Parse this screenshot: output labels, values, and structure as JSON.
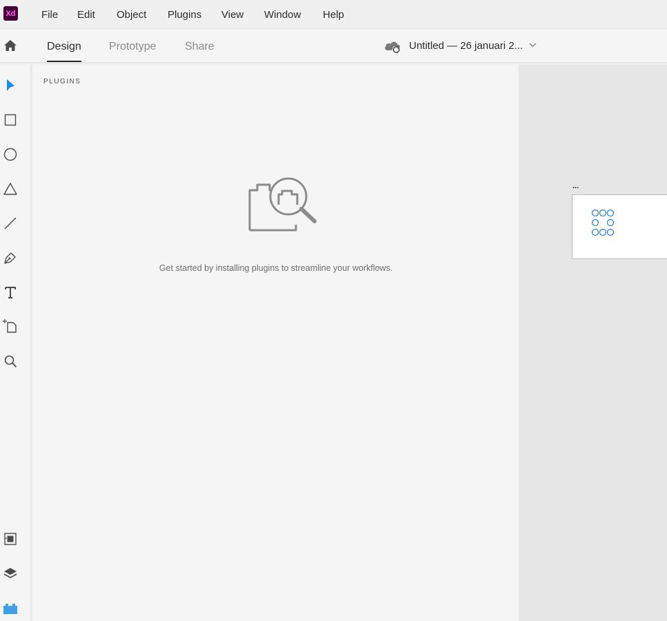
{
  "app": {
    "logo_text": "Xd",
    "logo_bg": "#470137",
    "logo_fg": "#ff61f6"
  },
  "menu": [
    "File",
    "Edit",
    "Object",
    "Plugins",
    "View",
    "Window",
    "Help"
  ],
  "tabs": {
    "home_icon": "home-icon",
    "items": [
      "Design",
      "Prototype",
      "Share"
    ],
    "active": "Design"
  },
  "document": {
    "title": "Untitled — 26 januari 2...",
    "sync_icon": "cloud-sync-icon"
  },
  "toolbar": {
    "tools": [
      "select-tool-icon",
      "rectangle-tool-icon",
      "ellipse-tool-icon",
      "polygon-tool-icon",
      "line-tool-icon",
      "pen-tool-icon",
      "text-tool-icon",
      "artboard-tool-icon",
      "zoom-tool-icon"
    ],
    "bottom": [
      "assets-icon",
      "layers-icon",
      "plugins-icon"
    ],
    "accent": "#1a8ee6",
    "plugins_accent": "#3fa0e8"
  },
  "plugins_panel": {
    "title": "PLUGINS",
    "empty_message": "Get started by installing plugins to streamline your workflows."
  },
  "canvas": {
    "artboard_label": "...",
    "background": "#e6e6e6"
  }
}
